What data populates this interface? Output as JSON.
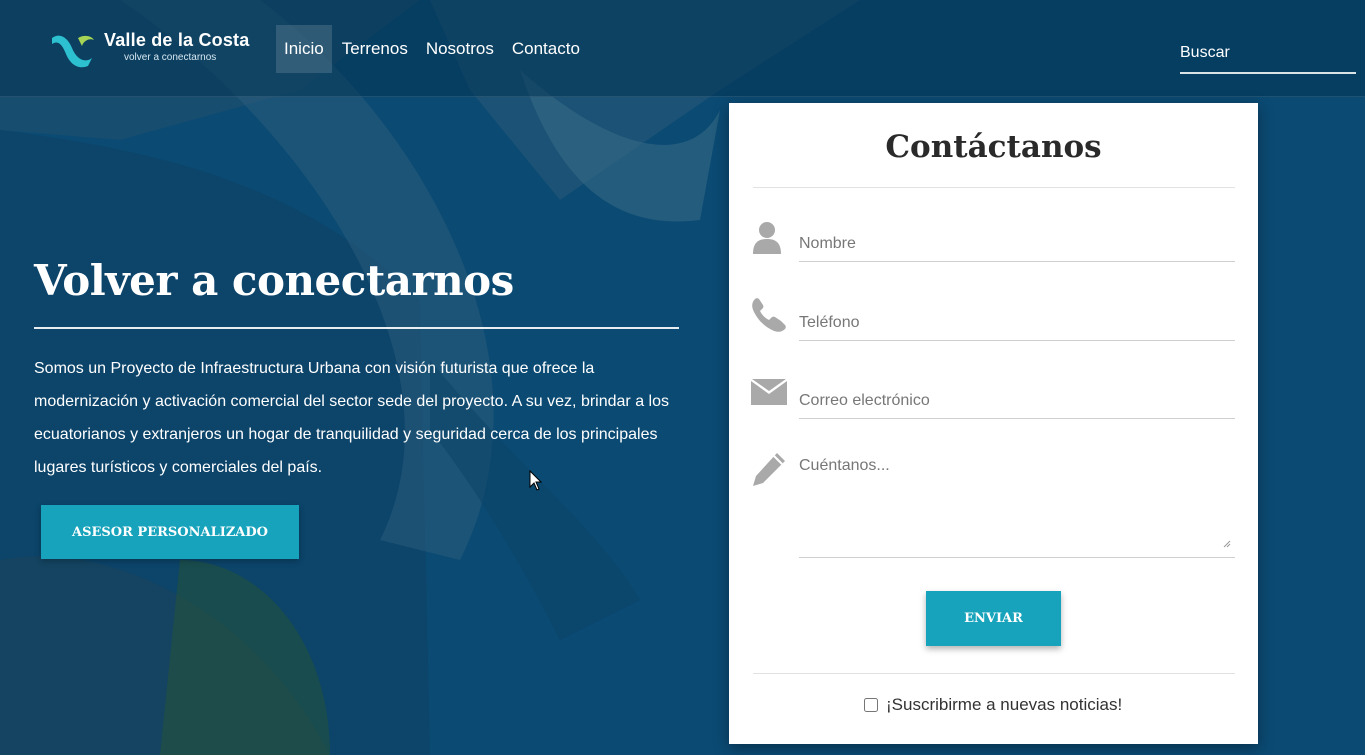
{
  "brand": {
    "name": "Valle de la Costa",
    "tagline": "volver a conectarnos"
  },
  "nav": {
    "items": [
      {
        "label": "Inicio",
        "active": true
      },
      {
        "label": "Terrenos"
      },
      {
        "label": "Nosotros"
      },
      {
        "label": "Contacto"
      }
    ]
  },
  "search": {
    "placeholder": "Buscar"
  },
  "hero": {
    "title": "Volver a conectarnos",
    "text": "Somos un Proyecto de Infraestructura Urbana con visión futurista que ofrece la modernización y activación comercial del sector sede del proyecto. A su vez, brindar a los ecuatorianos y extranjeros un hogar de tranquilidad y seguridad cerca de los principales lugares turísticos y comerciales del país.",
    "cta": "ASESOR PERSONALIZADO"
  },
  "contact": {
    "title": "Contáctanos",
    "fields": {
      "name": "Nombre",
      "phone": "Teléfono",
      "email": "Correo electrónico",
      "message": "Cuéntanos..."
    },
    "send": "ENVIAR",
    "subscribe": "¡Suscribirme a nuevas noticias!"
  },
  "colors": {
    "accent": "#17a3bb",
    "background": "#0b4a73",
    "card": "#ffffff"
  },
  "icons": [
    "user-icon",
    "phone-icon",
    "envelope-icon",
    "pencil-icon"
  ]
}
